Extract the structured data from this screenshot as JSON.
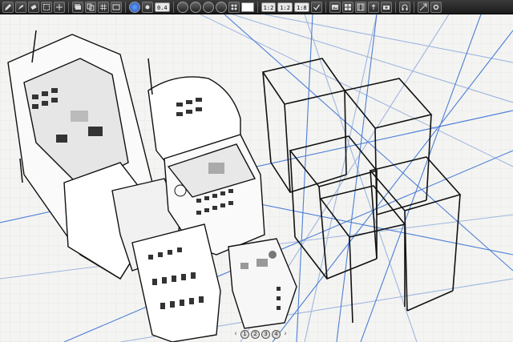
{
  "toolbar": {
    "zoom_label": "0.4",
    "page_buttons": [
      "1:2",
      "1:2",
      "1:8"
    ]
  },
  "pager": {
    "prev_label": "‹",
    "next_label": "›",
    "pages": [
      "1",
      "2",
      "3",
      "4"
    ]
  },
  "colors": {
    "toolbar_bg": "#2a2a2a",
    "canvas_bg": "#f4f4f2",
    "grid": "#dcdcdc",
    "guide_blue": "#4d7fd6",
    "guide_light": "#9fb6df",
    "ink": "#111111"
  }
}
